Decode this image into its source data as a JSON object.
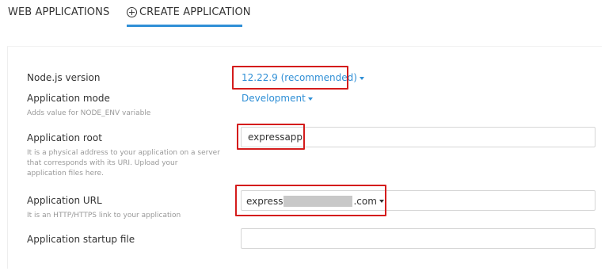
{
  "tabs": {
    "web_applications": "WEB APPLICATIONS",
    "create_application": "CREATE APPLICATION"
  },
  "form": {
    "nodejs_version": {
      "label": "Node.js version",
      "value": "12.22.9 (recommended)"
    },
    "application_mode": {
      "label": "Application mode",
      "hint": "Adds value for NODE_ENV variable",
      "value": "Development"
    },
    "application_root": {
      "label": "Application root",
      "hint_lines": [
        "It is a physical address to your application on a server",
        "that corresponds with its URI. Upload your",
        "application files here."
      ],
      "value": "expressapp"
    },
    "application_url": {
      "label": "Application URL",
      "hint": "It is an HTTP/HTTPS link to your application",
      "prefix": "express",
      "suffix": ".com"
    },
    "application_startup_file": {
      "label": "Application startup file",
      "value": ""
    }
  },
  "colors": {
    "accent": "#2f8fd6",
    "highlight_box": "#d41c1c"
  }
}
